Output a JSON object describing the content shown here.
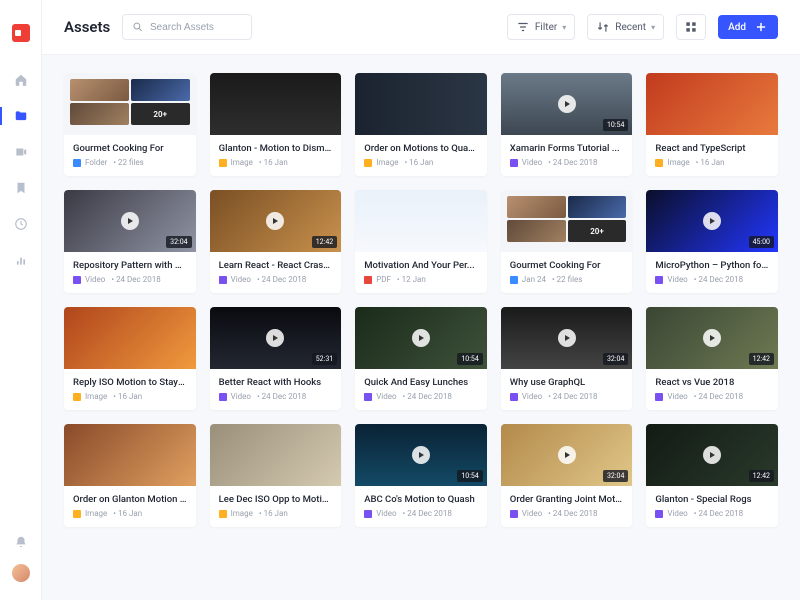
{
  "header": {
    "title": "Assets",
    "search_placeholder": "Search Assets",
    "filter_label": "Filter",
    "sort_label": "Recent",
    "add_label": "Add"
  },
  "assets": [
    {
      "title": "Gourmet Cooking For",
      "type": "folder",
      "type_label": "Folder",
      "date": "22 files",
      "badge": "20+",
      "thumb_css": ""
    },
    {
      "title": "Glanton - Motion to Dismiss...",
      "type": "image",
      "type_label": "Image",
      "date": "16 Jan",
      "thumb_css": "background:linear-gradient(180deg,#1a1a1a,#2e2e2e)"
    },
    {
      "title": "Order on Motions to Quash (...",
      "type": "image",
      "type_label": "Image",
      "date": "16 Jan",
      "thumb_css": "background:linear-gradient(90deg,#1b2330,#2b3644)"
    },
    {
      "title": "Xamarin Forms Tutorial ...",
      "type": "video",
      "type_label": "Video",
      "date": "24 Dec 2018",
      "badge": "10:54",
      "play": true,
      "thumb_css": "background:linear-gradient(180deg,#6b7a88,#3d4752)"
    },
    {
      "title": "React and TypeScript",
      "type": "image",
      "type_label": "Image",
      "date": "16 Jan",
      "thumb_css": "background:linear-gradient(135deg,#c23b1e,#e87a3d)"
    },
    {
      "title": "Repository Pattern with C# ...",
      "type": "video",
      "type_label": "Video",
      "date": "24 Dec 2018",
      "badge": "32:04",
      "play": true,
      "thumb_css": "background:linear-gradient(135deg,#3a3a44,#9094a4)"
    },
    {
      "title": "Learn React - React Crash ...",
      "type": "video",
      "type_label": "Video",
      "date": "24 Dec 2018",
      "badge": "12:42",
      "play": true,
      "thumb_css": "background:linear-gradient(135deg,#7a4f24,#c9924d)"
    },
    {
      "title": "Motivation And Your Per...",
      "type": "pdf",
      "type_label": "PDF",
      "date": "12 Jan",
      "thumb_css": "background:linear-gradient(180deg,#e9f1fa,#f6f9fd)"
    },
    {
      "title": "Gourmet Cooking For",
      "type": "folder",
      "type_label": "Jan 24",
      "date": "22 files",
      "badge": "20+",
      "thumb_css": ""
    },
    {
      "title": "MicroPython – Python for ...",
      "type": "video",
      "type_label": "Video",
      "date": "24 Dec 2018",
      "badge": "45:00",
      "play": true,
      "thumb_css": "background:linear-gradient(135deg,#0b0f2a,#2236ff)"
    },
    {
      "title": "Reply ISO Motion to Stay Pe...",
      "type": "image",
      "type_label": "Image",
      "date": "16 Jan",
      "thumb_css": "background:linear-gradient(135deg,#b0451c,#f09a3e)"
    },
    {
      "title": "Better React with Hooks",
      "type": "video",
      "type_label": "Video",
      "date": "24 Dec 2018",
      "badge": "52:31",
      "play": true,
      "thumb_css": "background:linear-gradient(180deg,#090b10,#232731)"
    },
    {
      "title": "Quick And Easy Lunches",
      "type": "video",
      "type_label": "Video",
      "date": "24 Dec 2018",
      "badge": "10:54",
      "play": true,
      "thumb_css": "background:linear-gradient(135deg,#1a2b1a,#3e523a)"
    },
    {
      "title": "Why use GraphQL",
      "type": "video",
      "type_label": "Video",
      "date": "24 Dec 2018",
      "badge": "32:04",
      "play": true,
      "thumb_css": "background:linear-gradient(180deg,#1a1a1a,#444)"
    },
    {
      "title": "React vs Vue 2018",
      "type": "video",
      "type_label": "Video",
      "date": "24 Dec 2018",
      "badge": "12:42",
      "play": true,
      "thumb_css": "background:linear-gradient(135deg,#3a4634,#6e7a52)"
    },
    {
      "title": "Order on Glanton Motion to...",
      "type": "image",
      "type_label": "Image",
      "date": "16 Jan",
      "thumb_css": "background:linear-gradient(135deg,#8a4a2a,#e0a060)"
    },
    {
      "title": "Lee Dec ISO Opp to Motion",
      "type": "image",
      "type_label": "Image",
      "date": "16 Jan",
      "thumb_css": "background:linear-gradient(135deg,#9a8f7a,#d4cab0)"
    },
    {
      "title": "ABC Co's Motion to Quash",
      "type": "video",
      "type_label": "Video",
      "date": "24 Dec 2018",
      "badge": "10:54",
      "play": true,
      "thumb_css": "background:linear-gradient(180deg,#0a2234,#134a66)"
    },
    {
      "title": "Order Granting Joint Motion",
      "type": "video",
      "type_label": "Video",
      "date": "24 Dec 2018",
      "badge": "32:04",
      "play": true,
      "thumb_css": "background:linear-gradient(135deg,#b38a4a,#e0c78a)"
    },
    {
      "title": "Glanton - Special Rogs",
      "type": "video",
      "type_label": "Video",
      "date": "24 Dec 2018",
      "badge": "12:42",
      "play": true,
      "thumb_css": "background:linear-gradient(135deg,#121a14,#2a3a2c)"
    }
  ]
}
